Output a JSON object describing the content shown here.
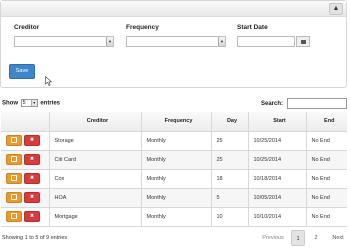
{
  "filter_panel": {
    "creditor_label": "Creditor",
    "frequency_label": "Frequency",
    "start_date_label": "Start Date",
    "creditor_value": "",
    "frequency_value": "",
    "start_date_value": "",
    "save_label": "Save"
  },
  "table_controls": {
    "show_prefix": "Show",
    "page_length": "5",
    "show_suffix": "entries",
    "search_label": "Search:",
    "search_value": ""
  },
  "table": {
    "headers": [
      "",
      "Creditor",
      "Frequency",
      "Day",
      "Start",
      "End"
    ],
    "rows": [
      {
        "creditor": "Storage",
        "frequency": "Monthly",
        "day": "25",
        "start": "10/25/2014",
        "end": "No End"
      },
      {
        "creditor": "Citi Card",
        "frequency": "Monthly",
        "day": "25",
        "start": "10/25/2014",
        "end": "No End"
      },
      {
        "creditor": "Cox",
        "frequency": "Monthly",
        "day": "18",
        "start": "10/18/2014",
        "end": "No End"
      },
      {
        "creditor": "HOA",
        "frequency": "Monthly",
        "day": "5",
        "start": "10/05/2014",
        "end": "No End"
      },
      {
        "creditor": "Mortgage",
        "frequency": "Monthly",
        "day": "10",
        "start": "10/10/2014",
        "end": "No End"
      }
    ]
  },
  "footer": {
    "info": "Showing 1 to 5 of 9 entries",
    "previous_label": "Previous",
    "pages": [
      "1",
      "2"
    ],
    "next_label": "Next"
  },
  "icons": {
    "collapse": "chevron-up-icon",
    "calendar": "calendar-icon",
    "edit": "edit-icon",
    "delete": "delete-icon"
  },
  "colors": {
    "save_button": "#3f86c8",
    "edit_button": "#e99a2c",
    "delete_button": "#d73c3c"
  }
}
